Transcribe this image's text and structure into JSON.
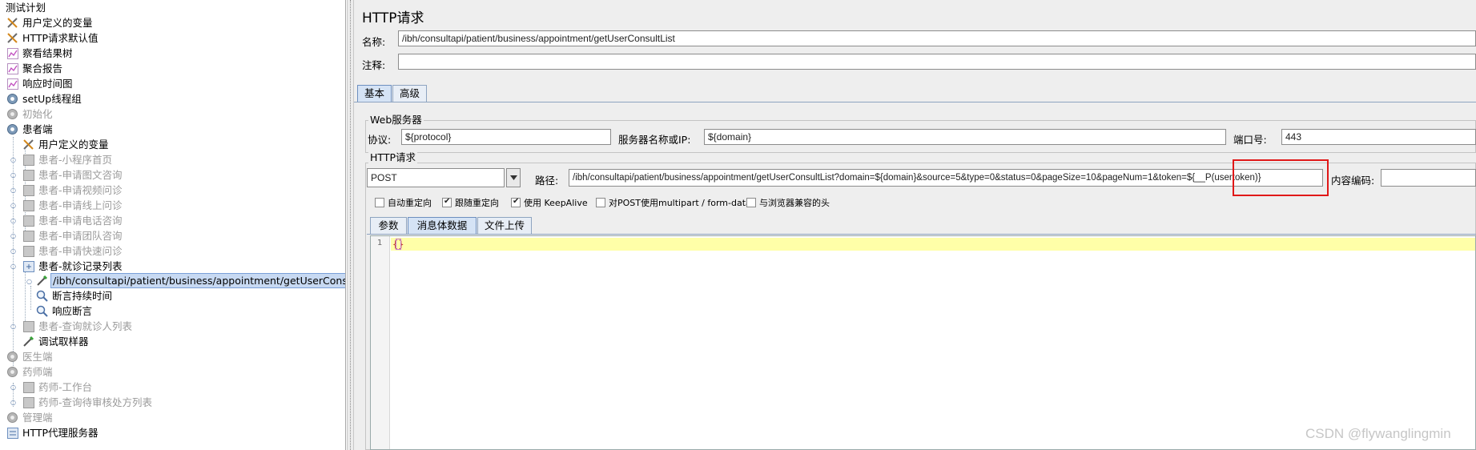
{
  "tree": {
    "nodes": [
      {
        "label": "测试计划",
        "icon": "test-plan-icon",
        "disabled": false,
        "selected": false
      },
      {
        "label": "用户定义的变量",
        "icon": "wrench-icon",
        "disabled": false,
        "selected": false
      },
      {
        "label": "HTTP请求默认值",
        "icon": "wrench-icon",
        "disabled": false,
        "selected": false
      },
      {
        "label": "察看结果树",
        "icon": "chart-listener-icon",
        "disabled": false,
        "selected": false
      },
      {
        "label": "聚合报告",
        "icon": "chart-listener-icon",
        "disabled": false,
        "selected": false
      },
      {
        "label": "响应时间图",
        "icon": "chart-listener-icon",
        "disabled": false,
        "selected": false
      },
      {
        "label": "setUp线程组",
        "icon": "gear-icon",
        "disabled": false,
        "selected": false
      },
      {
        "label": "初始化",
        "icon": "gear-icon",
        "disabled": true,
        "selected": false
      },
      {
        "label": "患者端",
        "icon": "gear-icon",
        "disabled": false,
        "selected": false
      },
      {
        "label": "用户定义的变量",
        "icon": "wrench-icon",
        "disabled": false,
        "selected": false
      },
      {
        "label": "患者-小程序首页",
        "icon": "controller-icon",
        "disabled": true,
        "selected": false
      },
      {
        "label": "患者-申请图文咨询",
        "icon": "controller-icon",
        "disabled": true,
        "selected": false
      },
      {
        "label": "患者-申请视频问诊",
        "icon": "controller-icon",
        "disabled": true,
        "selected": false
      },
      {
        "label": "患者-申请线上问诊",
        "icon": "controller-icon",
        "disabled": true,
        "selected": false
      },
      {
        "label": "患者-申请电话咨询",
        "icon": "controller-icon",
        "disabled": true,
        "selected": false
      },
      {
        "label": "患者-申请团队咨询",
        "icon": "controller-icon",
        "disabled": true,
        "selected": false
      },
      {
        "label": "患者-申请快速问诊",
        "icon": "controller-icon",
        "disabled": true,
        "selected": false
      },
      {
        "label": "患者-就诊记录列表",
        "icon": "controller-icon",
        "disabled": false,
        "selected": false
      },
      {
        "label": "/ibh/consultapi/patient/business/appointment/getUserConsultList",
        "icon": "pipette-icon",
        "disabled": false,
        "selected": true
      },
      {
        "label": "断言持续时间",
        "icon": "magnifier-icon",
        "disabled": false,
        "selected": false
      },
      {
        "label": "响应断言",
        "icon": "magnifier-icon",
        "disabled": false,
        "selected": false
      },
      {
        "label": "患者-查询就诊人列表",
        "icon": "controller-icon",
        "disabled": true,
        "selected": false
      },
      {
        "label": "调试取样器",
        "icon": "pipette-icon",
        "disabled": false,
        "selected": false
      },
      {
        "label": "医生端",
        "icon": "gear-icon",
        "disabled": true,
        "selected": false
      },
      {
        "label": "药师端",
        "icon": "gear-icon",
        "disabled": true,
        "selected": false
      },
      {
        "label": "药师-工作台",
        "icon": "controller-icon",
        "disabled": true,
        "selected": false
      },
      {
        "label": "药师-查询待审核处方列表",
        "icon": "controller-icon",
        "disabled": true,
        "selected": false
      },
      {
        "label": "管理端",
        "icon": "gear-icon",
        "disabled": true,
        "selected": false
      },
      {
        "label": "HTTP代理服务器",
        "icon": "proxy-icon",
        "disabled": false,
        "selected": false
      }
    ]
  },
  "panel": {
    "title": "HTTP请求",
    "name_label": "名称:",
    "name_value": "/ibh/consultapi/patient/business/appointment/getUserConsultList",
    "comment_label": "注释:",
    "comment_value": "",
    "tabs": [
      "基本",
      "高级"
    ],
    "web_server": {
      "group_title": "Web服务器",
      "protocol_label": "协议:",
      "protocol_value": "${protocol}",
      "server_label": "服务器名称或IP:",
      "server_value": "${domain}",
      "port_label": "端口号:",
      "port_value": "443"
    },
    "http_request": {
      "group_title": "HTTP请求",
      "method_value": "POST",
      "path_label": "路径:",
      "path_value": "/ibh/consultapi/patient/business/appointment/getUserConsultList?domain=${domain}&source=5&type=0&status=0&pageSize=10&pageNum=1&token=${__P(usertoken)}",
      "encoding_label": "内容编码:",
      "encoding_value": ""
    },
    "checkboxes": [
      {
        "label": "自动重定向",
        "checked": false
      },
      {
        "label": "跟随重定向",
        "checked": true
      },
      {
        "label": "使用 KeepAlive",
        "checked": true
      },
      {
        "label": "对POST使用multipart / form-data",
        "checked": false
      },
      {
        "label": "与浏览器兼容的头",
        "checked": false
      }
    ],
    "body_tabs": [
      "参数",
      "消息体数据",
      "文件上传"
    ],
    "editor": {
      "line_number": "1",
      "content": "{}"
    }
  },
  "watermark": "CSDN @flywanglingmin",
  "colors": {
    "selection": "#c7d9f2",
    "highlight_line": "#ffffa8",
    "red_annotation": "#e01818",
    "disabled_text": "#9a9a9a"
  }
}
